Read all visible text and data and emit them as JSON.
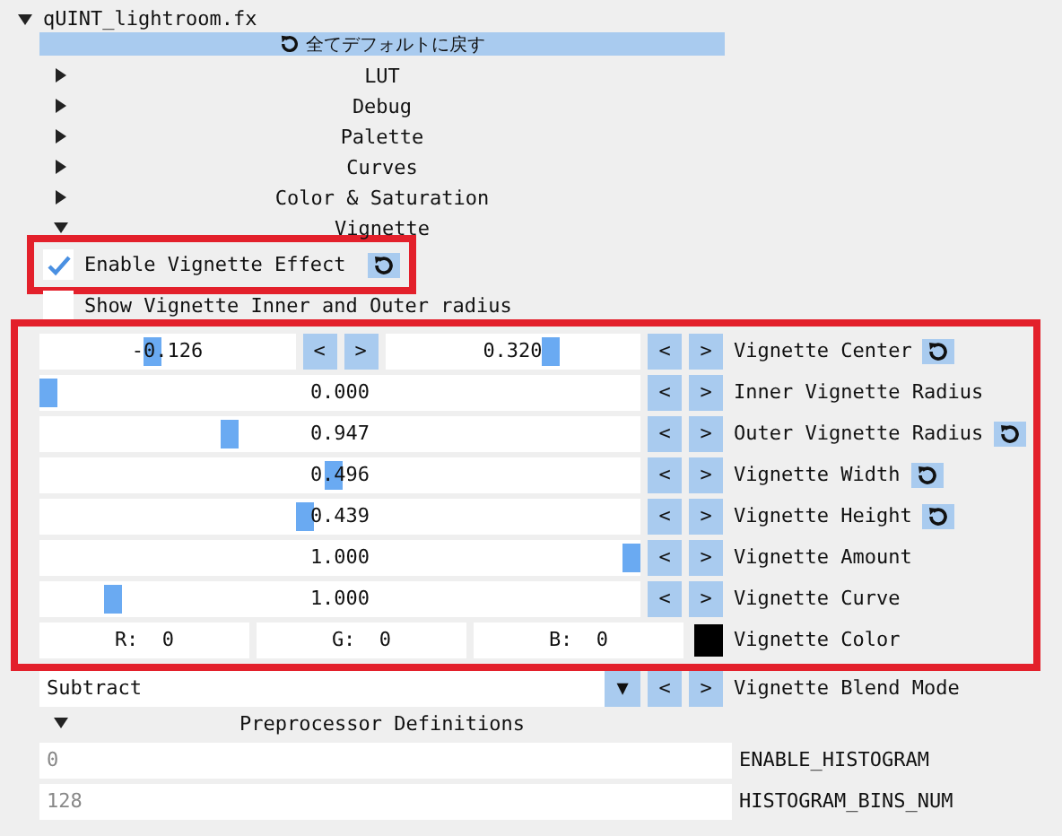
{
  "tree": {
    "title": "qUINT_lightroom.fx",
    "expanded": true,
    "reset_all": "全てデフォルトに戻す",
    "sections": [
      {
        "label": "LUT",
        "expanded": false
      },
      {
        "label": "Debug",
        "expanded": false
      },
      {
        "label": "Palette",
        "expanded": false
      },
      {
        "label": "Curves",
        "expanded": false
      },
      {
        "label": "Color & Saturation",
        "expanded": false
      },
      {
        "label": "Vignette",
        "expanded": true
      }
    ],
    "checkboxes": [
      {
        "label": "Enable Vignette Effect",
        "checked": true,
        "reset": true,
        "highlighted": true
      },
      {
        "label": "Show Vignette Inner and Outer radius",
        "checked": false,
        "reset": false,
        "highlighted": false
      }
    ],
    "settings_group": {
      "highlighted": true,
      "rows": [
        {
          "kind": "slider2",
          "fields": [
            {
              "value": "-0.126",
              "level": 0.44,
              "buttons": [
                "<",
                ">"
              ]
            },
            {
              "value": "0.320",
              "level": 0.66,
              "buttons": [
                "<",
                ">"
              ]
            }
          ],
          "label": "Vignette Center",
          "reset": true
        },
        {
          "kind": "slider",
          "value": "0.000",
          "level": 0,
          "buttons": [
            "<",
            ">"
          ],
          "label": "Inner Vignette Radius",
          "reset": false
        },
        {
          "kind": "slider",
          "value": "0.947",
          "level": 0.31,
          "buttons": [
            "<",
            ">"
          ],
          "label": "Outer Vignette Radius",
          "reset": true
        },
        {
          "kind": "slider",
          "value": "0.496",
          "level": 0.49,
          "buttons": [
            "<",
            ">"
          ],
          "label": "Vignette Width",
          "reset": true
        },
        {
          "kind": "slider",
          "value": "0.439",
          "level": 0.44,
          "buttons": [
            "<",
            ">"
          ],
          "label": "Vignette Height",
          "reset": true
        },
        {
          "kind": "slider",
          "value": "1.000",
          "level": 1,
          "buttons": [
            "<",
            ">"
          ],
          "label": "Vignette Amount",
          "reset": false
        },
        {
          "kind": "slider",
          "value": "1.000",
          "level": 0.11,
          "buttons": [
            "<",
            ">"
          ],
          "label": "Vignette Curve",
          "reset": false
        },
        {
          "kind": "color",
          "channels": [
            "R:  0",
            "G:  0",
            "B:  0"
          ],
          "color": "#000000",
          "label": "Vignette Color",
          "reset": false
        }
      ]
    },
    "blend": {
      "value": "Subtract",
      "dropdown": "▼",
      "buttons": [
        "<",
        ">"
      ],
      "label": "Vignette Blend Mode"
    },
    "preprocessor": {
      "label": "Preprocessor Definitions",
      "expanded": true,
      "definitions": [
        {
          "placeholder": "0",
          "name": "ENABLE_HISTOGRAM"
        },
        {
          "placeholder": "128",
          "name": "HISTOGRAM_BINS_NUM"
        }
      ]
    }
  }
}
